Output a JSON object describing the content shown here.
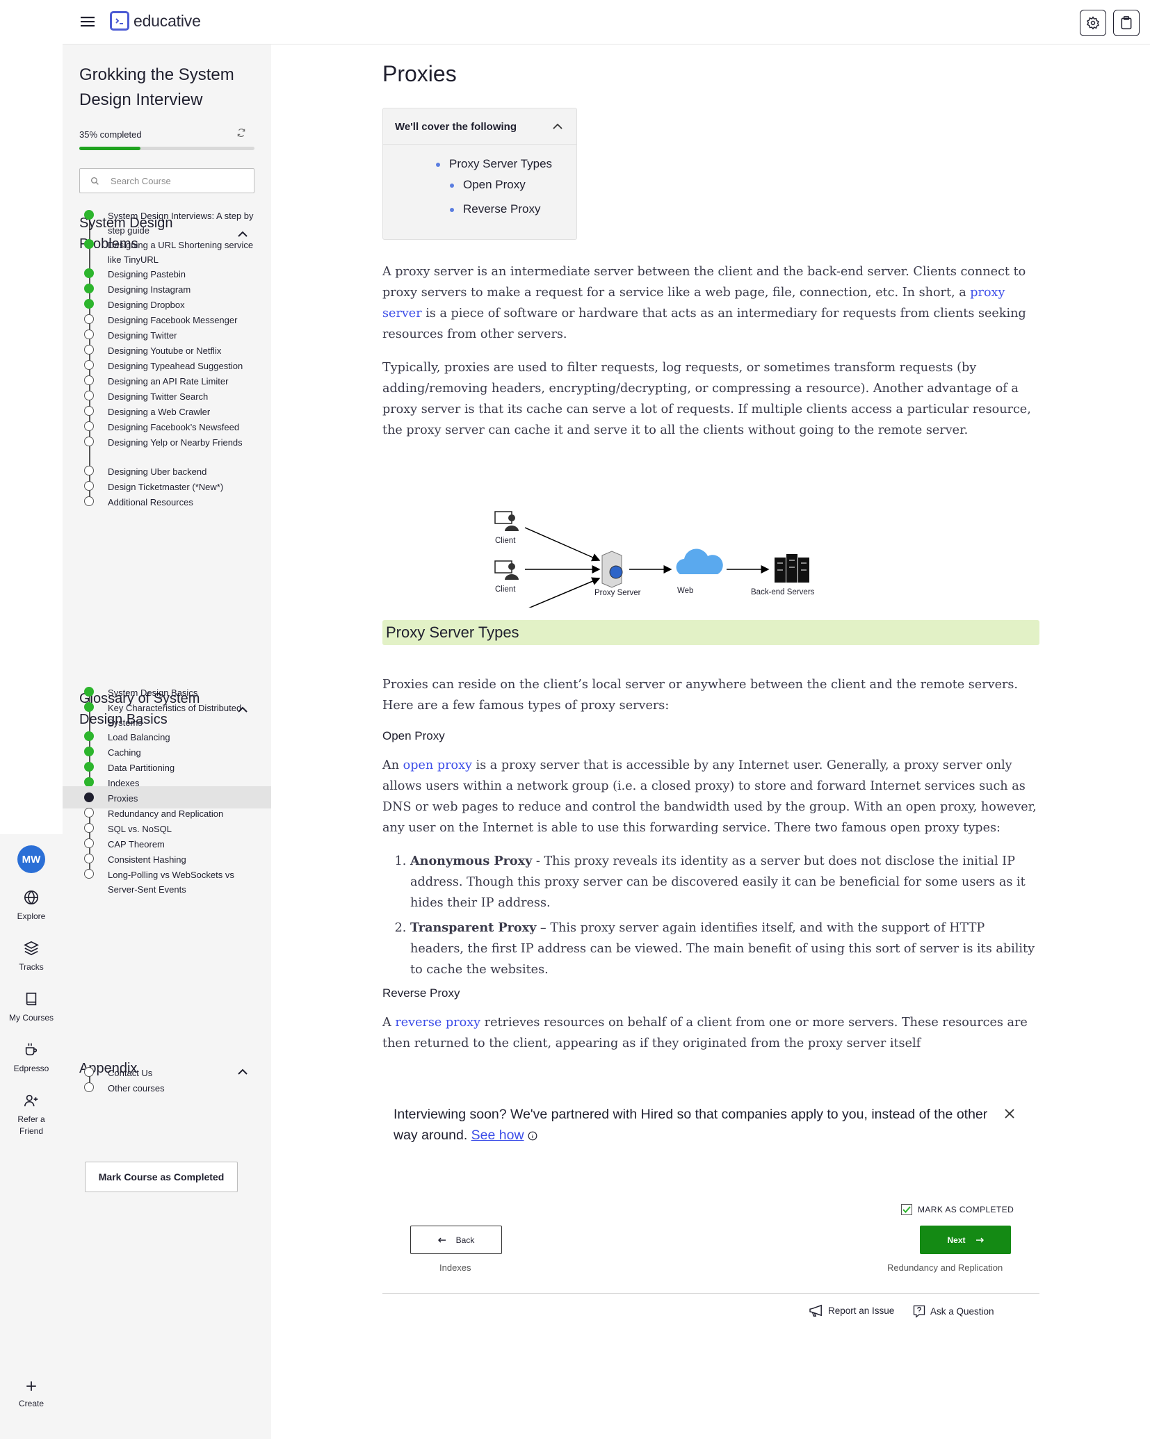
{
  "app": {
    "logo_text": "educative"
  },
  "rail": {
    "avatar_initials": "MW",
    "items": [
      {
        "label_1": "Explore",
        "label_2": "",
        "icon": "globe-icon"
      },
      {
        "label_1": "Tracks",
        "label_2": "",
        "icon": "layers-icon"
      },
      {
        "label_1": "My Courses",
        "label_2": "",
        "icon": "book-icon"
      },
      {
        "label_1": "Edpresso",
        "label_2": "",
        "icon": "coffee-icon"
      },
      {
        "label_1": "Refer a",
        "label_2": "Friend",
        "icon": "add-user-icon"
      },
      {
        "label_1": "Create",
        "label_2": "",
        "icon": "plus-icon"
      }
    ]
  },
  "sidebar": {
    "course_title": "Grokking the System Design Interview",
    "progress_label": "35% completed",
    "progress_fraction": 0.35,
    "search_placeholder": "Search Course",
    "sections": [
      {
        "title": "System Design Problems",
        "lessons": [
          {
            "label": "System Design Interviews: A step by step guide",
            "status": "done"
          },
          {
            "label": "Designing a URL Shortening service like TinyURL",
            "status": "done"
          },
          {
            "label": "Designing Pastebin",
            "status": "done"
          },
          {
            "label": "Designing Instagram",
            "status": "done"
          },
          {
            "label": "Designing Dropbox",
            "status": "done"
          },
          {
            "label": "Designing Facebook Messenger",
            "status": "todo"
          },
          {
            "label": "Designing Twitter",
            "status": "todo"
          },
          {
            "label": "Designing Youtube or Netflix",
            "status": "todo"
          },
          {
            "label": "Designing Typeahead Suggestion",
            "status": "todo"
          },
          {
            "label": "Designing an API Rate Limiter",
            "status": "todo"
          },
          {
            "label": "Designing Twitter Search",
            "status": "todo"
          },
          {
            "label": "Designing a Web Crawler",
            "status": "todo"
          },
          {
            "label": "Designing Facebook’s Newsfeed",
            "status": "todo"
          },
          {
            "label": "Designing Yelp or Nearby Friends",
            "status": "todo"
          },
          {
            "label": "Designing Uber backend",
            "status": "todo"
          },
          {
            "label": "Design Ticketmaster (*New*)",
            "status": "todo"
          },
          {
            "label": "Additional Resources",
            "status": "todo"
          }
        ]
      },
      {
        "title": "Glossary of System Design Basics",
        "lessons": [
          {
            "label": "System Design Basics",
            "status": "done"
          },
          {
            "label": "Key Characteristics of Distributed Systems",
            "status": "done"
          },
          {
            "label": "Load Balancing",
            "status": "done"
          },
          {
            "label": "Caching",
            "status": "done"
          },
          {
            "label": "Data Partitioning",
            "status": "done"
          },
          {
            "label": "Indexes",
            "status": "done"
          },
          {
            "label": "Proxies",
            "status": "current"
          },
          {
            "label": "Redundancy and Replication",
            "status": "todo"
          },
          {
            "label": "SQL vs. NoSQL",
            "status": "todo"
          },
          {
            "label": "CAP Theorem",
            "status": "todo"
          },
          {
            "label": "Consistent Hashing",
            "status": "todo"
          },
          {
            "label": "Long-Polling vs WebSockets vs Server-Sent Events",
            "status": "todo"
          }
        ]
      },
      {
        "title": "Appendix",
        "lessons": [
          {
            "label": "Contact Us",
            "status": "todo"
          },
          {
            "label": "Other courses",
            "status": "todo"
          }
        ]
      }
    ],
    "mark_course_completed": "Mark Course as Completed"
  },
  "main": {
    "title": "Proxies",
    "toc": {
      "heading": "We'll cover the following",
      "items": [
        "Proxy Server Types",
        "Open Proxy",
        "Reverse Proxy"
      ]
    },
    "para1": {
      "a": "A proxy server is an intermediate server between the client and the back-end server. Clients connect to proxy servers to make a request for a service like a web page, file, connection, etc. In short, a ",
      "link": "proxy server",
      "b": " is a piece of software or hardware that acts as an intermediary for requests from clients seeking resources from other servers."
    },
    "para2": "Typically, proxies are used to filter requests, log requests, or sometimes transform requests (by adding/removing headers, encrypting/decrypting, or compressing a resource). Another advantage of a proxy server is that its cache can serve a lot of requests. If multiple clients access a particular resource, the proxy server can cache it and serve it to all the clients without going to the remote server.",
    "diagram": {
      "client_label": "Client",
      "proxy_label": "Proxy Server",
      "web_label": "Web",
      "backend_label": "Back-end Servers"
    },
    "section_heading": "Proxy Server Types",
    "para3": "Proxies can reside on the client’s local server or anywhere between the client and the remote servers. Here are a few famous types of proxy servers:",
    "open_proxy_heading": "Open Proxy",
    "para4": {
      "a": "An ",
      "link": "open proxy",
      "b": " is a proxy server that is accessible by any Internet user. Generally, a proxy server only allows users within a network group (i.e. a closed proxy) to store and forward Internet services such as DNS or web pages to reduce and control the bandwidth used by the group. With an open proxy, however, any user on the Internet is able to use this forwarding service. There two famous open proxy types:"
    },
    "list": [
      {
        "bold": "Anonymous Proxy",
        "text": " - This proxy reveals its identity as a server but does not disclose the initial IP address. Though this proxy server can be discovered easily it can be beneficial for some users as it hides their IP address."
      },
      {
        "bold": "Transparent Proxy",
        "text": " – This proxy server again identifies itself, and with the support of HTTP headers, the first IP address can be viewed. The main benefit of using this sort of server is its ability to cache the websites."
      }
    ],
    "reverse_proxy_heading": "Reverse Proxy",
    "para5": {
      "a": "A ",
      "link": "reverse proxy",
      "b": " retrieves resources on behalf of a client from one or more servers. These resources are then returned to the client, appearing as if they originated from the proxy server itself"
    },
    "promo": {
      "text": "Interviewing soon? We've partnered with Hired so that companies apply to you, instead of the other way around. ",
      "link": "See how"
    },
    "mark_as_completed": "MARK AS COMPLETED",
    "back_label": "Back",
    "back_sub": "Indexes",
    "next_label": "Next",
    "next_sub": "Redundancy and Replication",
    "report_issue": "Report an Issue",
    "ask_question": "Ask a Question",
    "colors": {
      "accent": "#3d4ee8",
      "done": "#2db52d",
      "next_button": "#148a14",
      "heading_bg": "#e2f1c6"
    }
  }
}
